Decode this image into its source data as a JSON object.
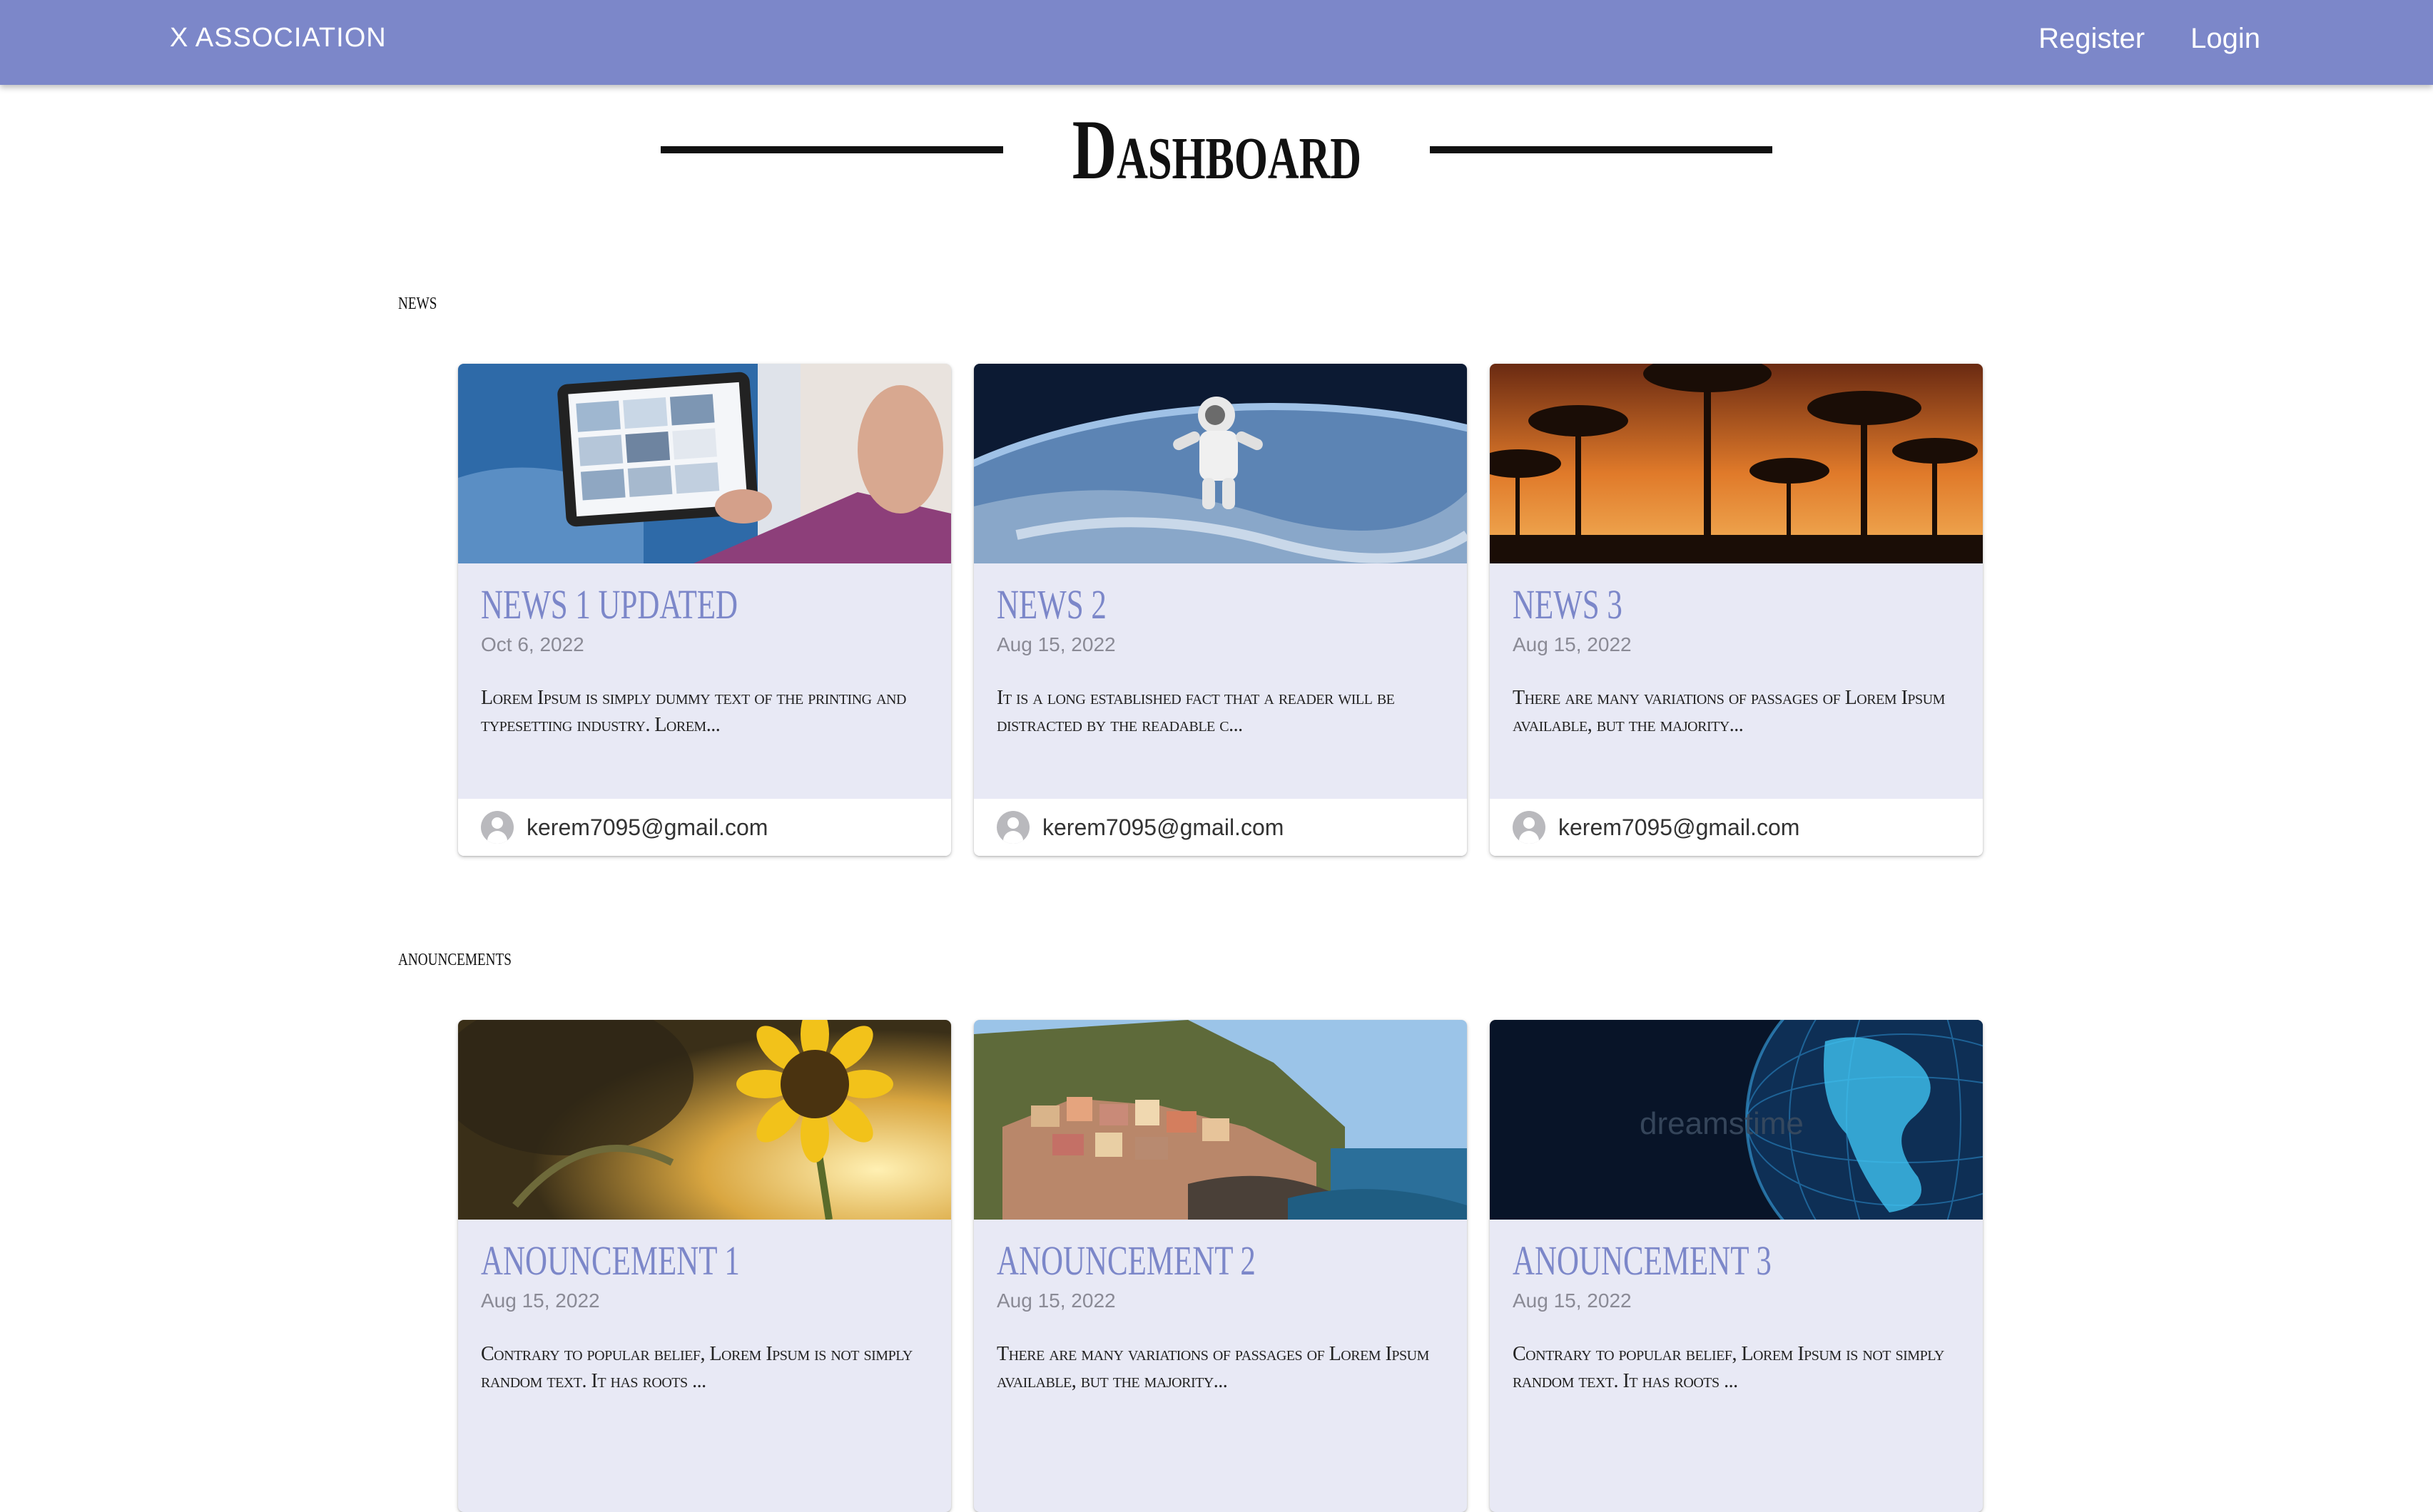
{
  "header": {
    "brand": "X ASSOCIATION",
    "nav": {
      "register": "Register",
      "login": "Login"
    }
  },
  "page_title": "Dashboard",
  "sections": {
    "news": {
      "label": "NEWS",
      "cards": [
        {
          "title": "NEWS 1 UPDATED",
          "date": "Oct 6, 2022",
          "excerpt": "Lorem Ipsum is simply dummy text of the printing and typesetting industry. Lorem...",
          "author": "kerem7095@gmail.com",
          "image": "tablet-photo"
        },
        {
          "title": "NEWS 2",
          "date": "Aug 15, 2022",
          "excerpt": "It is a long established fact that a reader will be distracted by the readable c...",
          "author": "kerem7095@gmail.com",
          "image": "astronaut-earth-photo"
        },
        {
          "title": "NEWS 3",
          "date": "Aug 15, 2022",
          "excerpt": "There are many variations of passages of Lorem Ipsum available, but the majority...",
          "author": "kerem7095@gmail.com",
          "image": "palm-sunset-photo"
        }
      ]
    },
    "anouncements": {
      "label": "ANOUNCEMENTS",
      "cards": [
        {
          "title": "ANOUNCEMENT 1",
          "date": "Aug 15, 2022",
          "excerpt": "Contrary to popular belief, Lorem Ipsum is not simply random text. It has roots ...",
          "image": "sunflower-photo"
        },
        {
          "title": "ANOUNCEMENT 2",
          "date": "Aug 15, 2022",
          "excerpt": "There are many variations of passages of Lorem Ipsum available, but the majority...",
          "image": "coastal-village-photo"
        },
        {
          "title": "ANOUNCEMENT 3",
          "date": "Aug 15, 2022",
          "excerpt": "Contrary to popular belief, Lorem Ipsum is not simply random text. It has roots ...",
          "image": "digital-globe-photo",
          "watermark": "dreamstime"
        }
      ]
    }
  },
  "colors": {
    "primary": "#7c87c9",
    "card_bg": "#e8e9f5"
  }
}
